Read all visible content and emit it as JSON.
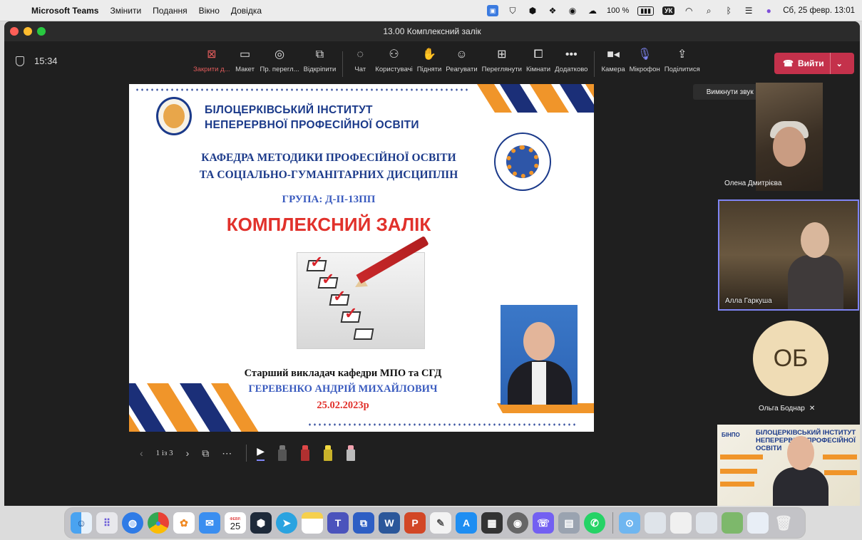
{
  "menubar": {
    "apple": "",
    "app_name": "Microsoft Teams",
    "menus": [
      "Змінити",
      "Подання",
      "Вікно",
      "Довідка"
    ],
    "battery": "100 %",
    "keyboard": "УК",
    "datetime": "Сб, 25 февр.  13:01"
  },
  "window": {
    "title": "13.00 Комплексний залік",
    "timer": "15:34"
  },
  "toolbar": {
    "items": [
      {
        "label": "Закрити д...",
        "icon": "close-share-icon"
      },
      {
        "label": "Макет",
        "icon": "layout-icon"
      },
      {
        "label": "Пр. перегл...",
        "icon": "view-icon"
      },
      {
        "label": "Відкріпити",
        "icon": "popout-icon"
      },
      {
        "label": "Чат",
        "icon": "chat-icon"
      },
      {
        "label": "Користувачі",
        "icon": "people-icon"
      },
      {
        "label": "Підняти",
        "icon": "raise-hand-icon"
      },
      {
        "label": "Реагувати",
        "icon": "react-icon"
      },
      {
        "label": "Переглянути",
        "icon": "view-grid-icon"
      },
      {
        "label": "Кімнати",
        "icon": "rooms-icon"
      },
      {
        "label": "Додатково",
        "icon": "more-icon"
      },
      {
        "label": "Камера",
        "icon": "camera-icon"
      },
      {
        "label": "Мікрофон",
        "icon": "mic-icon"
      },
      {
        "label": "Поділитися",
        "icon": "share-icon"
      }
    ],
    "leave_label": "Вийти",
    "leave_color": "#c4314b"
  },
  "tooltip": "Вимкнути звук (⌘ + Shift + M)",
  "slide": {
    "institute_line1": "БІЛОЦЕРКІВСЬКИЙ ІНСТИТУТ",
    "institute_line2": "НЕПЕРЕРВНОЇ ПРОФЕСІЙНОЇ ОСВІТИ",
    "dept_line1": "КАФЕДРА МЕТОДИКИ ПРОФЕСІЙНОЇ ОСВІТИ",
    "dept_line2": "ТА СОЦІАЛЬНО-ГУМАНІТАРНИХ ДИСЦИПЛІН",
    "group": "ГРУПА: Д-ІІ-13ПП",
    "exam_title": "КОМПЛЕКСНИЙ ЗАЛІК",
    "teacher_role": "Старший викладач кафедри МПО та СГД",
    "teacher_name": "ГЕРЕВЕНКО АНДРІЙ МИХАЙЛОВИЧ",
    "date": "25.02.2023р",
    "accent_navy": "#1b2f78",
    "accent_orange": "#f0952a",
    "accent_red": "#e1312b"
  },
  "slide_controls": {
    "page": "1 із 3"
  },
  "participants": [
    {
      "name": "Олена Дмитрієва"
    },
    {
      "name": "Алла Гаркуша"
    },
    {
      "name": "Ольга Боднар",
      "initials": "ОБ",
      "muted": true
    }
  ],
  "self_view": {
    "logo_text": "БІНПО",
    "title_line1": "БІЛОЦЕРКІВСЬКИЙ ІНСТИТУТ",
    "title_line2": "НЕПЕРЕРВНОЇ ПРОФЕСІЙНОЇ ОСВІТИ"
  },
  "dock": {
    "apps": [
      "Finder",
      "Launchpad",
      "Safari",
      "Chrome",
      "Photos",
      "Mail",
      "Calendar",
      "Notion",
      "Telegram",
      "Notes",
      "Teams",
      "Word",
      "PowerPoint",
      "TextEdit",
      "App Store",
      "Calculator",
      "Disk Utility",
      "Viber",
      "Preview",
      "WhatsApp"
    ],
    "calendar_month": "ФЕВР.",
    "calendar_day": "25"
  }
}
